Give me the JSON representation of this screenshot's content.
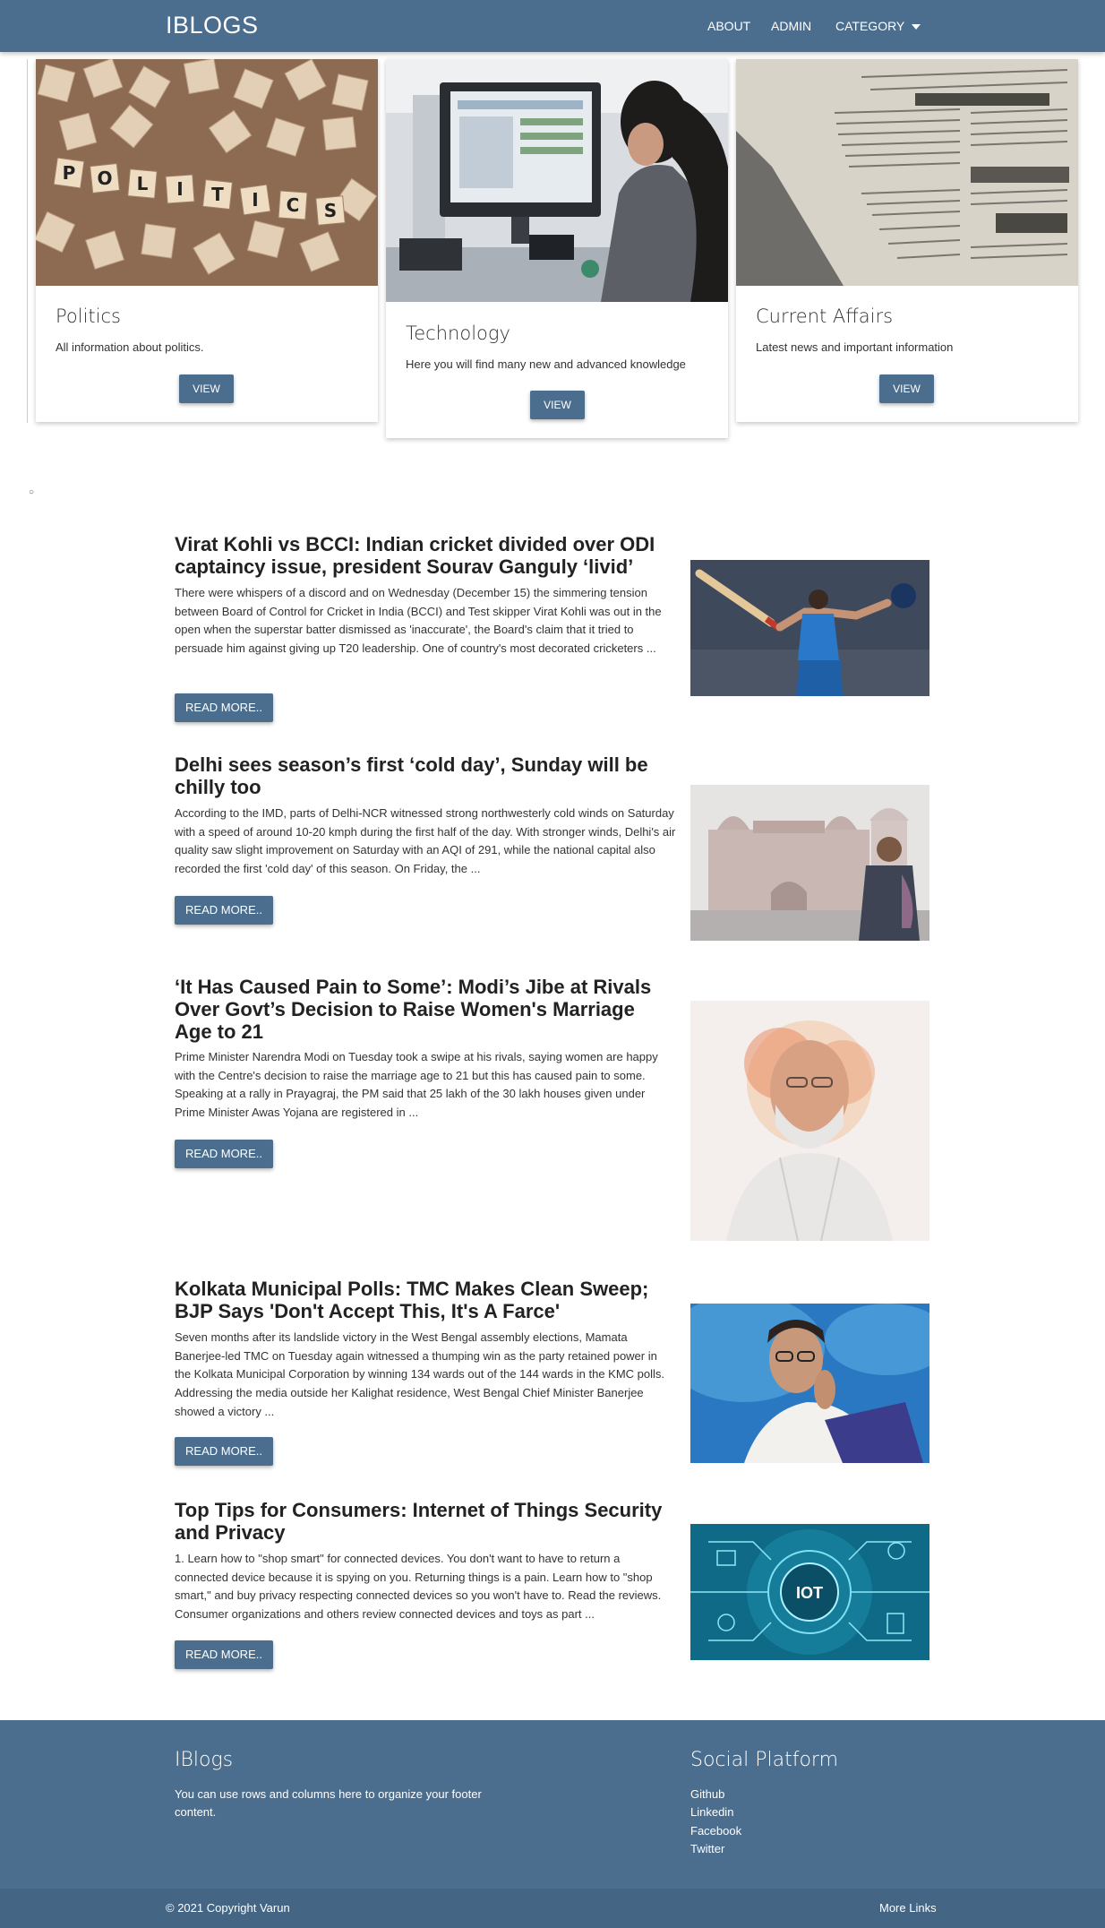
{
  "nav": {
    "brand": "IBLOGS",
    "about": "ABOUT",
    "admin": "ADMIN",
    "category": "CATEGORY"
  },
  "cards": [
    {
      "title": "Politics",
      "desc": "All information about politics.",
      "button": "VIEW",
      "image_icon": "scrabble-tiles-image"
    },
    {
      "title": "Technology",
      "desc": "Here you will find many new and advanced knowledge",
      "button": "VIEW",
      "image_icon": "office-computer-image"
    },
    {
      "title": "Current Affairs",
      "desc": "Latest news and important information",
      "button": "VIEW",
      "image_icon": "newspaper-image"
    }
  ],
  "stray_char": "○",
  "posts": [
    {
      "title": "Virat Kohli vs BCCI: Indian cricket divided over ODI captaincy issue, president Sourav Ganguly ‘livid’",
      "body": "There were whispers of a discord and on Wednesday (December 15) the simmering tension between Board of Control for Cricket in India (BCCI) and Test skipper Virat Kohli was out in the open when the superstar batter dismissed as 'inaccurate', the Board's claim that it tried to persuade him against giving up T20 leadership. One of country's most decorated cricketers ...",
      "button": "READ MORE..",
      "image_icon": "cricketer-celebrating-image"
    },
    {
      "title": "Delhi sees season’s first ‘cold day’, Sunday will be chilly too",
      "body": "According to the IMD, parts of Delhi-NCR witnessed strong northwesterly cold winds on Saturday with a speed of around 10-20 kmph during the first half of the day. With stronger winds, Delhi's air quality saw slight improvement on Saturday with an AQI of 291, while the national capital also recorded the first 'cold day' of this season. On Friday, the ...",
      "button": "READ MORE..",
      "image_icon": "red-fort-fog-image"
    },
    {
      "title": "‘It Has Caused Pain to Some’: Modi’s Jibe at Rivals Over Govt’s Decision to Raise Women's Marriage Age to 21",
      "body": "Prime Minister Narendra Modi on Tuesday took a swipe at his rivals, saying women are happy with the Centre's decision to raise the marriage age to 21 but this has caused pain to some. Speaking at a rally in Prayagraj, the PM said that 25 lakh of the 30 lakh houses given under Prime Minister Awas Yojana are registered in ...",
      "button": "READ MORE..",
      "image_icon": "watercolor-portrait-image"
    },
    {
      "title": "Kolkata Municipal Polls: TMC Makes Clean Sweep; BJP Says 'Don't Accept This, It's A Farce'",
      "body": "Seven months after its landslide victory in the West Bengal assembly elections, Mamata Banerjee-led TMC on Tuesday again witnessed a thumping win as the party retained power in the Kolkata Municipal Corporation by winning 134 wards out of the 144 wards in the KMC polls. Addressing the media outside her Kalighat residence, West Bengal Chief Minister Banerjee showed a victory ...",
      "button": "READ MORE..",
      "image_icon": "politician-portrait-image"
    },
    {
      "title": "Top Tips for Consumers: Internet of Things Security and Privacy",
      "body": "1. Learn how to \"shop smart\" for connected devices. You don't want to have to return a connected device because it is spying on you. Returning things is a pain. Learn how to \"shop smart,\" and buy privacy respecting connected devices so you won't have to. Read the reviews. Consumer organizations and others review connected devices and toys as part ...",
      "button": "READ MORE..",
      "image_icon": "iot-circuit-image",
      "image_text": "IOT"
    }
  ],
  "footer": {
    "title": "IBlogs",
    "text": "You can use rows and columns here to organize your footer content.",
    "social_title": "Social Platform",
    "links": [
      "Github",
      "Linkedin",
      "Facebook",
      "Twitter"
    ],
    "copyright": "© 2021 Copyright Varun",
    "more_links": "More Links"
  },
  "colors": {
    "primary": "#4b6d8e"
  }
}
